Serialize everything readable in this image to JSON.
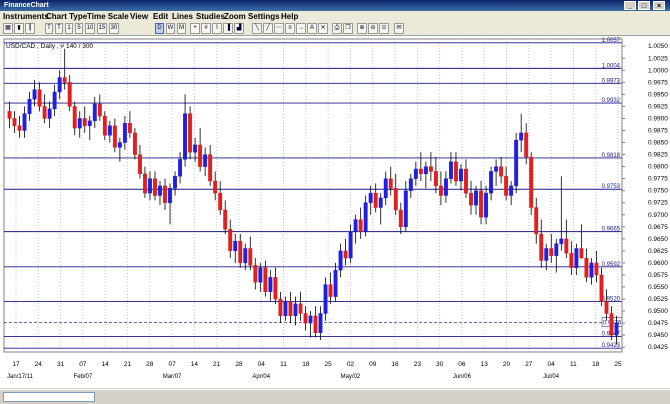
{
  "window": {
    "title": "FinanceChart"
  },
  "menu": [
    "Instruments",
    "Chart Type",
    "Time Scale",
    "View",
    "Edit",
    "Lines",
    "Studies",
    "Zoom",
    "Settings",
    "Help"
  ],
  "toolbar": [
    "T",
    "T",
    "1",
    "5",
    "10",
    "15",
    "30",
    "D",
    "W",
    "M"
  ],
  "chart": {
    "header": "USD/CAD , Daily , # 140 / 300",
    "price_label": "0.9476",
    "y_ticks": [
      "1.0050",
      "1.0025",
      "1.0000",
      "0.9975",
      "0.9950",
      "0.9925",
      "0.9900",
      "0.9875",
      "0.9850",
      "0.9825",
      "0.9800",
      "0.9775",
      "0.9750",
      "0.9725",
      "0.9700",
      "0.9675",
      "0.9650",
      "0.9625",
      "0.9600",
      "0.9575",
      "0.9550",
      "0.9525",
      "0.9500",
      "0.9475",
      "0.9450",
      "0.9425"
    ],
    "level_labels": [
      "1.0057",
      "1.0004",
      "0.9973",
      "0.9932",
      "0.9818",
      "0.9753",
      "0.9665",
      "0.9592",
      "0.9520",
      "0.9447",
      "0.9423"
    ],
    "x_day_labels": [
      "17",
      "24",
      "31",
      "07",
      "14",
      "21",
      "28",
      "07",
      "14",
      "21",
      "28",
      "04",
      "11",
      "18",
      "25",
      "02",
      "09",
      "16",
      "23",
      "30",
      "06",
      "13",
      "20",
      "27",
      "04",
      "11",
      "18",
      "25"
    ],
    "x_month_labels": [
      "Jan/17/11",
      "Feb/07",
      "Mar/07",
      "Apr/04",
      "May/02",
      "Jun/06",
      "Jul/04"
    ]
  },
  "chart_data": {
    "type": "candlestick",
    "instrument": "USD/CAD",
    "timeframe": "Daily",
    "ylim": [
      0.9415,
      1.0065
    ],
    "horizontal_levels": [
      1.0057,
      1.0004,
      0.9973,
      0.9932,
      0.9818,
      0.9753,
      0.9665,
      0.9592,
      0.952,
      0.9447,
      0.9423
    ],
    "current_price": 0.9476,
    "candles": [
      [
        0.9915,
        0.9935,
        0.988,
        0.99
      ],
      [
        0.99,
        0.9915,
        0.987,
        0.9885
      ],
      [
        0.9885,
        0.9905,
        0.986,
        0.9875
      ],
      [
        0.9875,
        0.9925,
        0.986,
        0.991
      ],
      [
        0.991,
        0.9955,
        0.9895,
        0.994
      ],
      [
        0.994,
        0.998,
        0.9925,
        0.996
      ],
      [
        0.996,
        0.9975,
        0.9915,
        0.9925
      ],
      [
        0.9925,
        0.995,
        0.989,
        0.99
      ],
      [
        0.99,
        0.9935,
        0.988,
        0.992
      ],
      [
        0.992,
        0.997,
        0.9905,
        0.9955
      ],
      [
        0.9955,
        1.0,
        0.994,
        0.9985
      ],
      [
        0.9985,
        1.0045,
        0.996,
        0.9975
      ],
      [
        0.9975,
        0.999,
        0.9915,
        0.9925
      ],
      [
        0.9925,
        0.9935,
        0.9865,
        0.988
      ],
      [
        0.988,
        0.9915,
        0.986,
        0.99
      ],
      [
        0.99,
        0.9925,
        0.987,
        0.9885
      ],
      [
        0.9885,
        0.9905,
        0.9855,
        0.9895
      ],
      [
        0.9895,
        0.9945,
        0.988,
        0.993
      ],
      [
        0.993,
        0.995,
        0.9895,
        0.9905
      ],
      [
        0.9905,
        0.9915,
        0.9855,
        0.9865
      ],
      [
        0.9865,
        0.9895,
        0.985,
        0.9885
      ],
      [
        0.9885,
        0.99,
        0.983,
        0.984
      ],
      [
        0.984,
        0.986,
        0.981,
        0.985
      ],
      [
        0.985,
        0.9905,
        0.9835,
        0.989
      ],
      [
        0.989,
        0.9915,
        0.986,
        0.987
      ],
      [
        0.987,
        0.988,
        0.9815,
        0.9825
      ],
      [
        0.9825,
        0.9845,
        0.9775,
        0.9785
      ],
      [
        0.9785,
        0.98,
        0.9735,
        0.9745
      ],
      [
        0.9745,
        0.979,
        0.973,
        0.9775
      ],
      [
        0.9775,
        0.979,
        0.973,
        0.974
      ],
      [
        0.974,
        0.977,
        0.972,
        0.976
      ],
      [
        0.976,
        0.9775,
        0.971,
        0.9725
      ],
      [
        0.9725,
        0.9765,
        0.968,
        0.9755
      ],
      [
        0.9755,
        0.979,
        0.974,
        0.978
      ],
      [
        0.978,
        0.983,
        0.9765,
        0.9815
      ],
      [
        0.9815,
        0.995,
        0.98,
        0.991
      ],
      [
        0.991,
        0.9925,
        0.9815,
        0.983
      ],
      [
        0.983,
        0.986,
        0.981,
        0.9845
      ],
      [
        0.9845,
        0.988,
        0.979,
        0.98
      ],
      [
        0.98,
        0.984,
        0.978,
        0.9825
      ],
      [
        0.9825,
        0.9845,
        0.976,
        0.977
      ],
      [
        0.977,
        0.979,
        0.973,
        0.9745
      ],
      [
        0.9745,
        0.977,
        0.97,
        0.971
      ],
      [
        0.971,
        0.973,
        0.966,
        0.967
      ],
      [
        0.967,
        0.969,
        0.961,
        0.9625
      ],
      [
        0.9625,
        0.966,
        0.96,
        0.9645
      ],
      [
        0.9645,
        0.966,
        0.959,
        0.96
      ],
      [
        0.96,
        0.964,
        0.9585,
        0.963
      ],
      [
        0.963,
        0.9655,
        0.9585,
        0.9595
      ],
      [
        0.9595,
        0.961,
        0.9545,
        0.956
      ],
      [
        0.956,
        0.96,
        0.954,
        0.959
      ],
      [
        0.959,
        0.9605,
        0.953,
        0.954
      ],
      [
        0.954,
        0.9585,
        0.952,
        0.957
      ],
      [
        0.957,
        0.959,
        0.9515,
        0.9525
      ],
      [
        0.9525,
        0.954,
        0.9475,
        0.949
      ],
      [
        0.949,
        0.953,
        0.948,
        0.952
      ],
      [
        0.952,
        0.954,
        0.9475,
        0.949
      ],
      [
        0.949,
        0.953,
        0.947,
        0.9515
      ],
      [
        0.9515,
        0.954,
        0.948,
        0.9495
      ],
      [
        0.9495,
        0.951,
        0.946,
        0.9475
      ],
      [
        0.9475,
        0.95,
        0.9445,
        0.949
      ],
      [
        0.949,
        0.951,
        0.9445,
        0.9455
      ],
      [
        0.9455,
        0.951,
        0.944,
        0.9495
      ],
      [
        0.9495,
        0.957,
        0.948,
        0.9555
      ],
      [
        0.9555,
        0.958,
        0.9515,
        0.953
      ],
      [
        0.953,
        0.96,
        0.952,
        0.9585
      ],
      [
        0.9585,
        0.964,
        0.957,
        0.9625
      ],
      [
        0.9625,
        0.965,
        0.9595,
        0.961
      ],
      [
        0.961,
        0.968,
        0.96,
        0.9665
      ],
      [
        0.9665,
        0.97,
        0.964,
        0.969
      ],
      [
        0.969,
        0.9715,
        0.965,
        0.9665
      ],
      [
        0.9665,
        0.974,
        0.9655,
        0.9725
      ],
      [
        0.9725,
        0.976,
        0.97,
        0.9745
      ],
      [
        0.9745,
        0.9765,
        0.9705,
        0.9715
      ],
      [
        0.9715,
        0.9745,
        0.968,
        0.9735
      ],
      [
        0.9735,
        0.979,
        0.972,
        0.9775
      ],
      [
        0.9775,
        0.98,
        0.974,
        0.9755
      ],
      [
        0.9755,
        0.9785,
        0.97,
        0.971
      ],
      [
        0.971,
        0.9725,
        0.966,
        0.9675
      ],
      [
        0.9675,
        0.977,
        0.9665,
        0.975
      ],
      [
        0.975,
        0.9785,
        0.9735,
        0.9775
      ],
      [
        0.9775,
        0.981,
        0.976,
        0.9795
      ],
      [
        0.9795,
        0.983,
        0.977,
        0.9785
      ],
      [
        0.9785,
        0.981,
        0.9755,
        0.98
      ],
      [
        0.98,
        0.983,
        0.977,
        0.979
      ],
      [
        0.979,
        0.982,
        0.9745,
        0.976
      ],
      [
        0.976,
        0.979,
        0.972,
        0.974
      ],
      [
        0.974,
        0.979,
        0.9725,
        0.9775
      ],
      [
        0.9775,
        0.983,
        0.9765,
        0.981
      ],
      [
        0.981,
        0.983,
        0.976,
        0.977
      ],
      [
        0.977,
        0.9805,
        0.975,
        0.9795
      ],
      [
        0.9795,
        0.9815,
        0.9735,
        0.9745
      ],
      [
        0.9745,
        0.977,
        0.97,
        0.972
      ],
      [
        0.972,
        0.976,
        0.97,
        0.975
      ],
      [
        0.975,
        0.977,
        0.968,
        0.9695
      ],
      [
        0.9695,
        0.976,
        0.968,
        0.9745
      ],
      [
        0.9745,
        0.98,
        0.973,
        0.979
      ],
      [
        0.979,
        0.9815,
        0.976,
        0.98
      ],
      [
        0.98,
        0.982,
        0.9765,
        0.978
      ],
      [
        0.978,
        0.98,
        0.973,
        0.974
      ],
      [
        0.974,
        0.977,
        0.972,
        0.976
      ],
      [
        0.976,
        0.987,
        0.9745,
        0.9855
      ],
      [
        0.9855,
        0.991,
        0.983,
        0.987
      ],
      [
        0.987,
        0.989,
        0.9805,
        0.982
      ],
      [
        0.982,
        0.983,
        0.97,
        0.9715
      ],
      [
        0.9715,
        0.9735,
        0.964,
        0.966
      ],
      [
        0.966,
        0.969,
        0.959,
        0.9605
      ],
      [
        0.9605,
        0.964,
        0.9585,
        0.963
      ],
      [
        0.963,
        0.966,
        0.96,
        0.9615
      ],
      [
        0.9615,
        0.965,
        0.958,
        0.964
      ],
      [
        0.964,
        0.978,
        0.9625,
        0.965
      ],
      [
        0.965,
        0.969,
        0.961,
        0.962
      ],
      [
        0.962,
        0.9645,
        0.9575,
        0.959
      ],
      [
        0.959,
        0.964,
        0.9575,
        0.963
      ],
      [
        0.963,
        0.968,
        0.961,
        0.961
      ],
      [
        0.961,
        0.963,
        0.956,
        0.957
      ],
      [
        0.957,
        0.961,
        0.9555,
        0.96
      ],
      [
        0.96,
        0.9625,
        0.956,
        0.9575
      ],
      [
        0.9575,
        0.959,
        0.951,
        0.952
      ],
      [
        0.952,
        0.9545,
        0.948,
        0.9495
      ],
      [
        0.9495,
        0.951,
        0.944,
        0.945
      ],
      [
        0.945,
        0.949,
        0.943,
        0.9476
      ]
    ]
  }
}
